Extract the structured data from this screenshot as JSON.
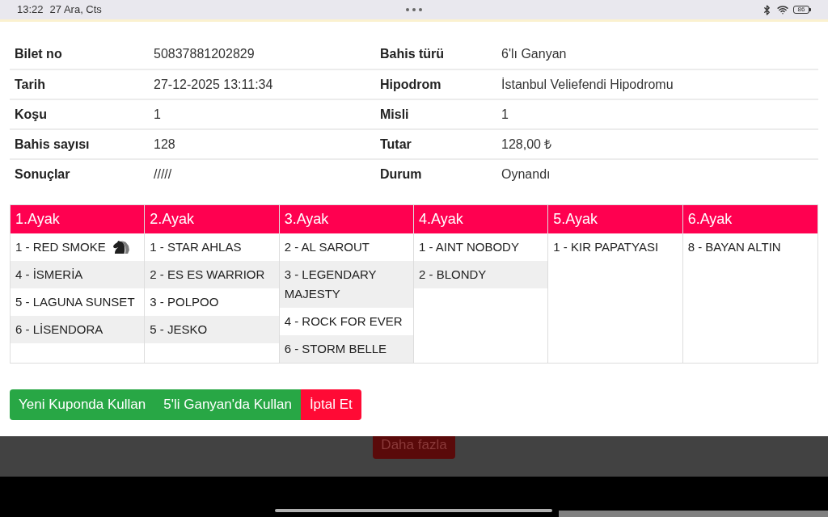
{
  "status_bar": {
    "time": "13:22",
    "date": "27 Ara, Cts",
    "battery": "86"
  },
  "details": [
    {
      "left": {
        "label": "Bilet no",
        "value": "50837881202829"
      },
      "right": {
        "label": "Bahis türü",
        "value": "6'lı Ganyan"
      }
    },
    {
      "left": {
        "label": "Tarih",
        "value": "27-12-2025 13:11:34"
      },
      "right": {
        "label": "Hipodrom",
        "value": "İstanbul Veliefendi Hipodromu"
      }
    },
    {
      "left": {
        "label": "Koşu",
        "value": "1"
      },
      "right": {
        "label": "Misli",
        "value": "1"
      }
    },
    {
      "left": {
        "label": "Bahis sayısı",
        "value": "128"
      },
      "right": {
        "label": "Tutar",
        "value": "128,00 ₺"
      }
    },
    {
      "left": {
        "label": "Sonuçlar",
        "value": "/////"
      },
      "right": {
        "label": "Durum",
        "value": "Oynandı"
      }
    }
  ],
  "legs": [
    {
      "title": "1.Ayak",
      "horses": [
        {
          "text": "1 - RED SMOKE",
          "horse_icon": true
        },
        {
          "text": "4 - İSMERİA",
          "horse_icon": false
        },
        {
          "text": "5 - LAGUNA SUNSET",
          "horse_icon": false
        },
        {
          "text": "6 - LİSENDORA",
          "horse_icon": false
        }
      ]
    },
    {
      "title": "2.Ayak",
      "horses": [
        {
          "text": "1 - STAR AHLAS",
          "horse_icon": false
        },
        {
          "text": "2 - ES ES WARRIOR",
          "horse_icon": false
        },
        {
          "text": "3 - POLPOO",
          "horse_icon": false
        },
        {
          "text": "5 - JESKO",
          "horse_icon": false
        }
      ]
    },
    {
      "title": "3.Ayak",
      "horses": [
        {
          "text": "2 - AL SAROUT",
          "horse_icon": false
        },
        {
          "text": "3 - LEGENDARY MAJESTY",
          "horse_icon": false
        },
        {
          "text": "4 - ROCK FOR EVER",
          "horse_icon": false
        },
        {
          "text": "6 - STORM BELLE",
          "horse_icon": false
        }
      ]
    },
    {
      "title": "4.Ayak",
      "horses": [
        {
          "text": "1 - AINT NOBODY",
          "horse_icon": false
        },
        {
          "text": "2 - BLONDY",
          "horse_icon": false
        }
      ]
    },
    {
      "title": "5.Ayak",
      "horses": [
        {
          "text": "1 - KIR PAPATYASI",
          "horse_icon": false
        }
      ]
    },
    {
      "title": "6.Ayak",
      "horses": [
        {
          "text": "8 - BAYAN ALTIN",
          "horse_icon": false
        }
      ]
    }
  ],
  "actions": [
    {
      "label": "Yeni Kuponda Kullan",
      "kind": "primary"
    },
    {
      "label": "5'li Ganyan'da Kullan",
      "kind": "primary"
    },
    {
      "label": "İptal Et",
      "kind": "danger"
    }
  ],
  "background_page": {
    "more_button": "Daha fazla"
  }
}
